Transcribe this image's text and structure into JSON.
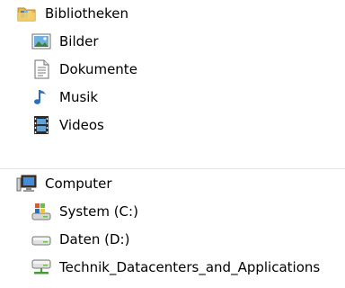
{
  "libraries": {
    "label": "Bibliotheken",
    "icon": "libraries-folder-icon",
    "items": [
      {
        "label": "Bilder",
        "icon": "pictures-icon"
      },
      {
        "label": "Dokumente",
        "icon": "documents-icon"
      },
      {
        "label": "Musik",
        "icon": "music-note-icon"
      },
      {
        "label": "Videos",
        "icon": "video-film-icon"
      }
    ]
  },
  "computer": {
    "label": "Computer",
    "icon": "computer-monitor-icon",
    "items": [
      {
        "label": "System (C:)",
        "icon": "system-drive-icon"
      },
      {
        "label": "Daten (D:)",
        "icon": "hard-drive-icon"
      },
      {
        "label": "Technik_Datacenters_and_Applications",
        "icon": "network-drive-icon"
      }
    ]
  },
  "colors": {
    "folder": "#e8b94a",
    "accent": "#2a6fb8",
    "separator": "#e4e4e4"
  }
}
